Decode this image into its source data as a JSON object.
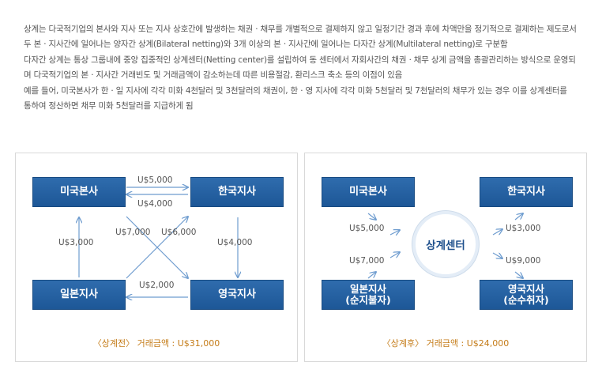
{
  "description": {
    "paragraphs": [
      "상계는 다국적기업의 본사와 지사 또는 지사 상호간에 발생하는 채권ㆍ채무를 개별적으로 결제하지 않고 일정기간 경과 후에 차액만을 정기적으로 결제하는 제도로서 두 본ㆍ지사간에 일어나는 양자간 상계(Bilateral netting)와 3개 이상의 본ㆍ지사간에 일어나는 다자간 상계(Multilateral netting)로 구분함",
      "다자간 상계는 통상 그룹내에 중앙 집중적인 상계센터(Netting center)를 설립하여 동 센터에서 자회사간의 채권ㆍ채무 상계 금액을 총괄관리하는 방식으로 운영되며 다국적기업의 본ㆍ지사간 거래빈도 및 거래금액이 감소하는데 따른 비용절감, 환리스크 축소 등의 이점이 있음",
      "예를 들어, 미국본사가 한ㆍ일 지사에 각각 미화 4천달러 및 3천달러의 채권이, 한ㆍ영 지사에 각각 미화 5천달러 및 7천달러의 채무가 있는 경우 이를 상계센터를 통하여 정산하면 채무 미화 5천달러를 지급하게 됨"
    ]
  },
  "before": {
    "nodes": {
      "us": "미국본사",
      "korea": "한국지사",
      "japan": "일본지사",
      "uk": "영국지사"
    },
    "flows": {
      "us_to_korea": "U$5,000",
      "korea_to_us": "U$4,000",
      "japan_to_us": "U$3,000",
      "korea_to_uk": "U$4,000",
      "us_to_uk": "U$7,000",
      "japan_to_korea": "U$6,000",
      "uk_to_japan": "U$2,000"
    },
    "caption_label": "〈상계전〉",
    "caption_amount": "거래금액 : U$31,000"
  },
  "after": {
    "center": "상계센터",
    "nodes": {
      "us": "미국본사",
      "korea": "한국지사",
      "japan": "일본지사\n(순지불자)",
      "uk": "영국지사\n(순수취자)"
    },
    "flows": {
      "us_in": "U$5,000",
      "japan_in": "U$7,000",
      "korea_out": "U$3,000",
      "uk_out": "U$9,000"
    },
    "caption_label": "〈상계후〉",
    "caption_amount": "거래금액 : U$24,000"
  },
  "colors": {
    "node": "#1d5797",
    "arrow": "#6e9ccf",
    "caption": "#c47b17"
  }
}
